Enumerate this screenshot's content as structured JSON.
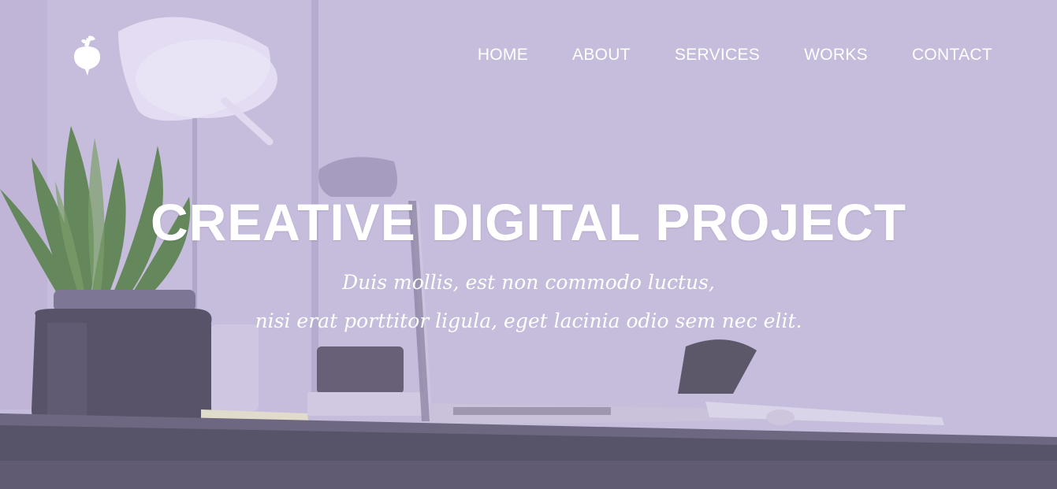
{
  "nav": {
    "items": [
      "HOME",
      "ABOUT",
      "SERVICES",
      "WORKS",
      "CONTACT"
    ]
  },
  "hero": {
    "title": "CREATIVE DIGITAL PROJECT",
    "subtitle_line1": "Duis mollis, est non commodo luctus,",
    "subtitle_line2": "nisi erat porttitor ligula, eget lacinia odio sem nec elit."
  },
  "logo": {
    "icon": "beet-icon",
    "color": "#ffffff"
  },
  "colors": {
    "overlay": "#c6bcda",
    "text": "#ffffff",
    "desk": "#3f3d4e",
    "plant": "#4f7d3c"
  }
}
